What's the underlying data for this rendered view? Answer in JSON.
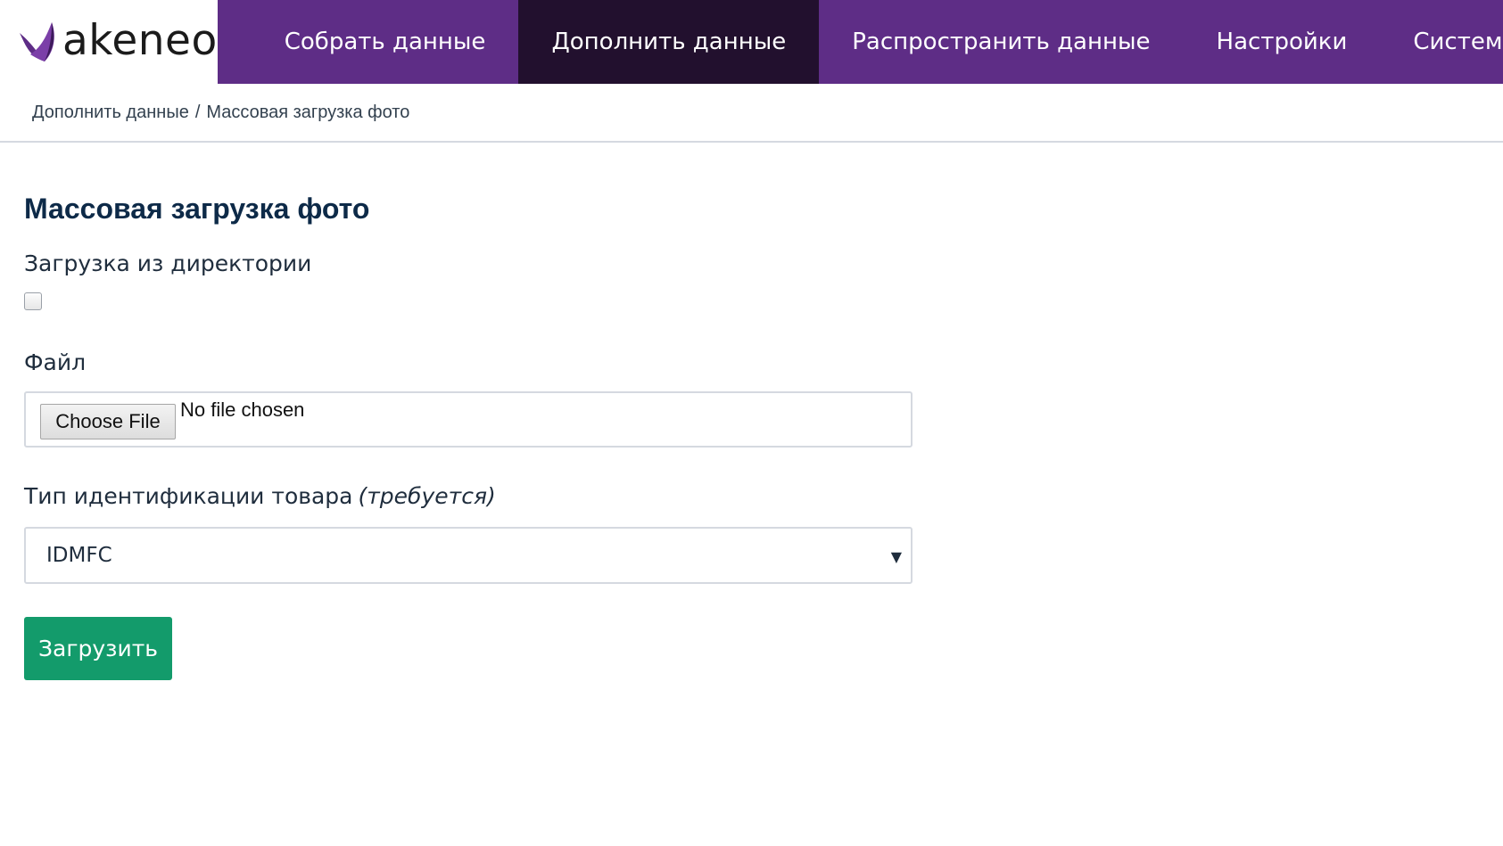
{
  "brand": {
    "name": "akeneo",
    "logo_icon": "akeneo-leaf-icon",
    "colors": {
      "nav_bg": "#5e2d86",
      "nav_active_bg": "#22102e",
      "primary_button": "#139b6b",
      "title": "#0d2a48"
    }
  },
  "nav": {
    "items": [
      {
        "label": "Собрать данные",
        "active": false
      },
      {
        "label": "Дополнить данные",
        "active": true
      },
      {
        "label": "Распространить данные",
        "active": false
      },
      {
        "label": "Настройки",
        "active": false
      },
      {
        "label": "Система",
        "active": false
      }
    ]
  },
  "breadcrumb": {
    "parent": "Дополнить данные",
    "separator": "/",
    "current": "Массовая загрузка фото"
  },
  "page": {
    "title": "Массовая загрузка фото"
  },
  "form": {
    "directory_upload": {
      "label": "Загрузка из директории",
      "checked": false
    },
    "file": {
      "label": "Файл",
      "button_label": "Choose File",
      "status": "No file chosen"
    },
    "id_type": {
      "label": "Тип идентификации товара",
      "required_note": "(требуется)",
      "selected": "IDMFC",
      "arrow_icon": "caret-down-icon"
    },
    "submit_label": "Загрузить"
  }
}
